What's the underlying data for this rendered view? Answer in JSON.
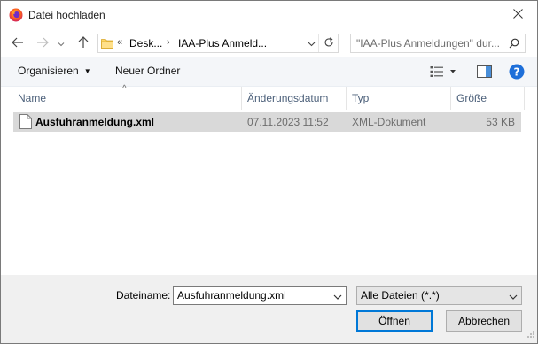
{
  "window": {
    "title": "Datei hochladen"
  },
  "navigation": {
    "breadcrumb_overflow": "«",
    "breadcrumb": [
      "Desk...",
      "IAA-Plus Anmeld..."
    ],
    "search_placeholder": "\"IAA-Plus Anmeldungen\" dur..."
  },
  "toolbar": {
    "organize_label": "Organisieren",
    "new_folder_label": "Neuer Ordner"
  },
  "columns": {
    "name": "Name",
    "modified": "Änderungsdatum",
    "type": "Typ",
    "size": "Größe"
  },
  "files": [
    {
      "name": "Ausfuhranmeldung.xml",
      "modified": "07.11.2023 11:52",
      "type": "XML-Dokument",
      "size": "53 KB",
      "selected": true
    }
  ],
  "footer": {
    "filename_label": "Dateiname:",
    "filename_value": "Ausfuhranmeldung.xml",
    "filetype_value": "Alle Dateien (*.*)",
    "open_label": "Öffnen",
    "cancel_label": "Abbrechen"
  },
  "icons": {
    "app": "firefox-icon",
    "close": "close-icon",
    "back": "back-arrow-icon",
    "forward": "forward-arrow-icon",
    "recent": "recent-locations-icon",
    "up": "up-arrow-icon",
    "folder": "folder-icon",
    "refresh": "refresh-icon",
    "search": "search-icon",
    "view": "view-options-icon",
    "preview": "preview-pane-icon",
    "help": "help-icon",
    "file": "file-icon"
  },
  "colors": {
    "selection": "#d9d9d9",
    "toolbar_bg": "#f4f6f9",
    "footer_bg": "#f0f0f0",
    "accent": "#0078d7",
    "help_blue": "#1e6fd9"
  }
}
